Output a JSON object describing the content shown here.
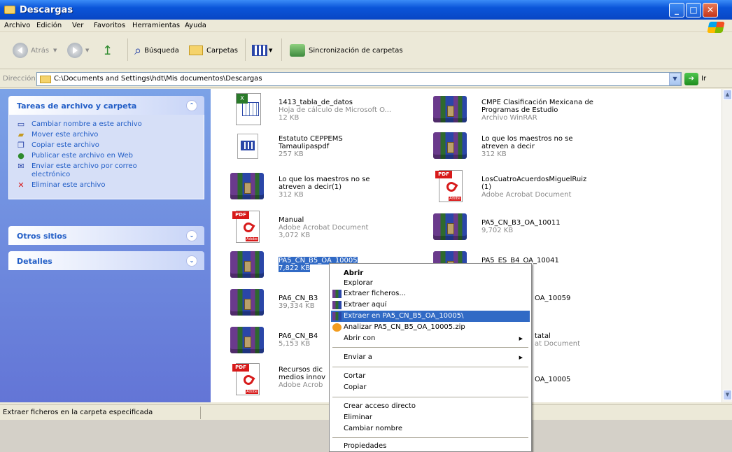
{
  "window": {
    "title": "Descargas"
  },
  "menu": [
    "Archivo",
    "Edición",
    "Ver",
    "Favoritos",
    "Herramientas",
    "Ayuda"
  ],
  "toolbar": {
    "back": "Atrás",
    "search": "Búsqueda",
    "folders": "Carpetas",
    "sync": "Sincronización de carpetas"
  },
  "address": {
    "label": "Dirección",
    "path": "C:\\Documents and Settings\\hdt\\Mis documentos\\Descargas",
    "go": "Ir"
  },
  "tasks": {
    "title": "Tareas de archivo y carpeta",
    "items": [
      "Cambiar nombre a este archivo",
      "Mover este archivo",
      "Copiar este archivo",
      "Publicar este archivo en Web",
      "Enviar este archivo por correo electrónico",
      "Eliminar este archivo"
    ],
    "icons": [
      "rename-icon",
      "move-icon",
      "copy-icon",
      "globe-icon",
      "mail-icon",
      "delete-icon"
    ]
  },
  "other_places": {
    "title": "Otros sitios"
  },
  "details": {
    "title": "Detalles"
  },
  "files": [
    {
      "name": "1413_tabla_de_datos",
      "line2": "Hoja de cálculo de Microsoft O...",
      "line3": "12 KB",
      "type": "excel"
    },
    {
      "name": "CMPE Clasificación Mexicana de",
      "line2": "Programas de Estudio",
      "line3": "Archivo WinRAR",
      "type": "winrar"
    },
    {
      "name": "Estatuto CEPPEMS",
      "line2": "Tamaulipaspdf",
      "line3": "257 KB",
      "type": "doc"
    },
    {
      "name": "Lo que los maestros no se",
      "line2": "atreven a decir",
      "line3": "312 KB",
      "type": "winrar"
    },
    {
      "name": "Lo que los maestros no se",
      "line2": "atreven a decir(1)",
      "line3": "312 KB",
      "type": "winrar"
    },
    {
      "name": "LosCuatroAcuerdosMiguelRuiz",
      "line2": "(1)",
      "line3": "Adobe Acrobat Document",
      "type": "pdf"
    },
    {
      "name": "Manual",
      "line2": "Adobe Acrobat Document",
      "line3": "3,072 KB",
      "type": "pdf"
    },
    {
      "name": "PA5_CN_B3_OA_10011",
      "line2": "9,702 KB",
      "line3": "",
      "type": "winrar"
    },
    {
      "name": "PA5_CN_B5_OA_10005",
      "line2": "7,822 KB",
      "line3": "",
      "type": "winrar",
      "selected": true
    },
    {
      "name": "PA5_ES_B4_OA_10041",
      "line2": "",
      "line3": "",
      "type": "winrar"
    },
    {
      "name": "PA6_CN_B3",
      "line2": "39,334 KB",
      "line3": "",
      "type": "winrar"
    },
    {
      "name": "OA_10059",
      "line2": "",
      "line3": "",
      "type": "winrar"
    },
    {
      "name": "PA6_CN_B4",
      "line2": "5,153 KB",
      "line3": "",
      "type": "winrar"
    },
    {
      "name": "tatal",
      "line2": "at Document",
      "line3": "",
      "type": "pdf"
    },
    {
      "name": "Recursos dic",
      "line2": "medios innov",
      "line3": "Adobe Acrob",
      "type": "pdf"
    },
    {
      "name": "OA_10005",
      "line2": "",
      "line3": "",
      "type": "winrar"
    }
  ],
  "context_menu": {
    "items": [
      "Abrir",
      "Explorar",
      "Extraer ficheros...",
      "Extraer aquí",
      "Extraer en PA5_CN_B5_OA_10005\\",
      "Analizar PA5_CN_B5_OA_10005.zip",
      "Abrir con",
      "Enviar a",
      "Cortar",
      "Copiar",
      "Crear acceso directo",
      "Eliminar",
      "Cambiar nombre",
      "Propiedades"
    ],
    "highlighted": "Extraer en PA5_CN_B5_OA_10005\\"
  },
  "status": {
    "text": "Extraer ficheros en la carpeta especificada"
  },
  "colors": {
    "title_bar": "#0a55d9",
    "task_pane": "#6375d6",
    "selection": "#316ac5",
    "link": "#215dc6"
  }
}
